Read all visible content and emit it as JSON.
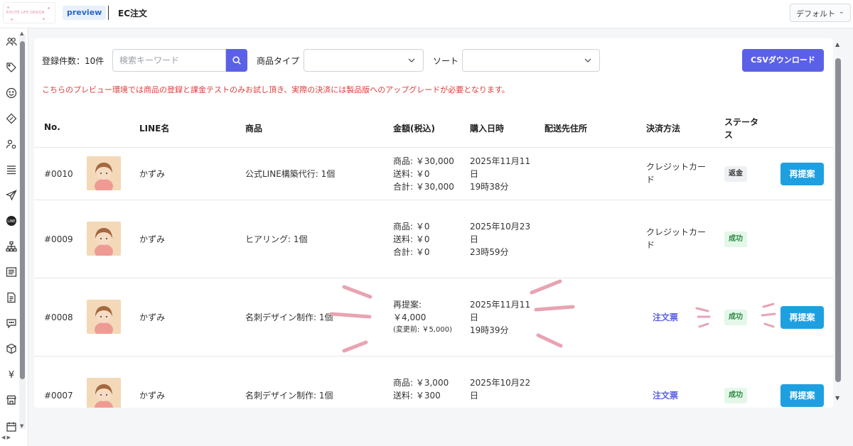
{
  "header": {
    "logo_text": "EXCITE LIFE DESIGN",
    "preview_label": "preview",
    "title": "EC注文",
    "view_select": "デフォルト"
  },
  "sidebar": {
    "icons": [
      "users-icon",
      "tag-icon",
      "smile-icon",
      "coupon-icon",
      "user-settings-icon",
      "list-icon",
      "send-icon",
      "line-icon",
      "tree-icon",
      "article-icon",
      "document-icon",
      "chat-icon",
      "box-icon",
      "yen-icon",
      "store-icon",
      "calendar-icon"
    ]
  },
  "toolbar": {
    "count_label": "登録件数：10件",
    "search_placeholder": "検索キーワード",
    "product_type_label": "商品タイプ",
    "product_type_value": "",
    "sort_label": "ソート",
    "sort_value": "",
    "csv_button": "CSVダウンロード"
  },
  "notice": "こちらのプレビュー環境では商品の登録と課金テストのみお試し頂き、実際の決済には製品版へのアップグレードが必要となります。",
  "table": {
    "headers": {
      "no": "No.",
      "line_name": "LINE名",
      "product": "商品",
      "amount": "金額(税込)",
      "purchase_date": "購入日時",
      "address": "配送先住所",
      "payment": "決済方法",
      "status_line1": "ステータ",
      "status_line2": "ス"
    },
    "rows": [
      {
        "no": "#0010",
        "line_name": "かずみ",
        "product": "公式LINE構築代行: 1個",
        "amount_1": "商品: ￥30,000",
        "amount_2": "送料: ￥0",
        "amount_3": "合計: ￥30,000",
        "date_1": "2025年11月11",
        "date_2": "日",
        "date_3": "19時38分",
        "payment_1": "クレジットカー",
        "payment_2": "ド",
        "status": "返金",
        "action": "再提案"
      },
      {
        "no": "#0009",
        "line_name": "かずみ",
        "product": "ヒアリング: 1個",
        "amount_1": "商品: ￥0",
        "amount_2": "送料: ￥0",
        "amount_3": "合計: ￥0",
        "date_1": "2025年10月23",
        "date_2": "日",
        "date_3": "23時59分",
        "payment_1": "クレジットカー",
        "payment_2": "ド",
        "status": "成功"
      },
      {
        "no": "#0008",
        "line_name": "かずみ",
        "product": "名刺デザイン制作: 1個",
        "amount_1": "再提案:",
        "amount_2": "￥4,000",
        "amount_3": "(変更前: ￥5,000)",
        "date_1": "2025年11月11",
        "date_2": "日",
        "date_3": "19時39分",
        "payment_link": "注文票",
        "status": "成功",
        "action": "再提案"
      },
      {
        "no": "#0007",
        "line_name": "かずみ",
        "product": "名刺デザイン制作: 1個",
        "amount_1": "商品: ￥3,000",
        "amount_2": "送料: ￥300",
        "date_1": "2025年10月22",
        "date_2": "日",
        "payment_link": "注文票",
        "status": "成功",
        "action": "再提案"
      }
    ]
  },
  "colors": {
    "primary": "#5b61e6",
    "action": "#1ea0e0",
    "notice": "#e03b3b",
    "success_bg": "#e4f7e8",
    "success_text": "#2e8a45",
    "highlight_marks": "#e8a3b3"
  }
}
